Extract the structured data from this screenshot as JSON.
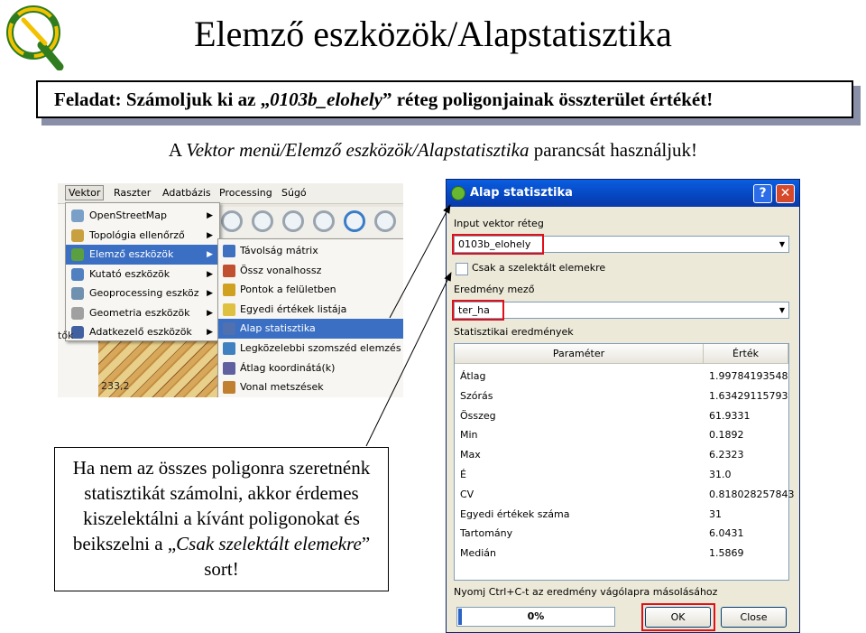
{
  "slide": {
    "title": "Elemző eszközök/Alapstatisztika",
    "task": {
      "prefix": "Feladat: Számoljuk ki az „",
      "layer": "0103b_elohely",
      "suffix": "” réteg poligonjainak összterület értékét!"
    },
    "instruction": {
      "prefix": "A ",
      "path": "Vektor menü/Elemző eszközök/Alapstatisztika",
      "suffix": " parancsát használjuk!"
    },
    "callout": {
      "text": "Ha nem az összes poligonra szeretnénk statisztikát számolni, akkor érdemes kiszelektálni a kívánt poligonokat és beikszelni a",
      "quote_open": "„",
      "quoted": "Csak szelektált elemekre",
      "quote_close": "” sort!"
    }
  },
  "menu_screenshot": {
    "menubar": [
      "Vektor",
      "Raszter",
      "Adatbázis",
      "Processing",
      "Súgó"
    ],
    "vector_menu": [
      {
        "label": "OpenStreetMap",
        "icon": "osm-icon",
        "color": "#7aa0c8"
      },
      {
        "label": "Topológia ellenőrző",
        "icon": "topology-icon",
        "color": "#c8a040"
      },
      {
        "label": "Elemző eszközök",
        "icon": "analysis-icon",
        "color": "#5aa040",
        "selected": true
      },
      {
        "label": "Kutató eszközök",
        "icon": "research-icon",
        "color": "#5080c0"
      },
      {
        "label": "Geoprocessing eszköz",
        "icon": "geoprocessing-icon",
        "color": "#7090b0"
      },
      {
        "label": "Geometria eszközök",
        "icon": "geometry-icon",
        "color": "#a0a0a0"
      },
      {
        "label": "Adatkezelő eszközök",
        "icon": "data-management-icon",
        "color": "#4060a0"
      }
    ],
    "analysis_submenu": [
      {
        "label": "Távolság mátrix",
        "icon": "distance-matrix-icon",
        "color": "#4070c0"
      },
      {
        "label": "Össz vonalhossz",
        "icon": "line-length-icon",
        "color": "#c05030"
      },
      {
        "label": "Pontok a felületben",
        "icon": "points-in-polygon-icon",
        "color": "#d0a020"
      },
      {
        "label": "Egyedi értékek listája",
        "icon": "unique-values-icon",
        "color": "#e0c040"
      },
      {
        "label": "Alap statisztika",
        "icon": "basic-stats-icon",
        "color": "#5070b0",
        "selected": true
      },
      {
        "label": "Legközelebbi szomszéd elemzés",
        "icon": "nearest-neighbour-icon",
        "color": "#4080c0"
      },
      {
        "label": "Átlag koordinátá(k)",
        "icon": "mean-coordinates-icon",
        "color": "#6060a0"
      },
      {
        "label": "Vonal metszések",
        "icon": "line-intersections-icon",
        "color": "#c08030"
      }
    ],
    "map_label": "233,2",
    "side_fragment": "tők"
  },
  "dialog": {
    "title": "Alap statisztika",
    "input_layer_label": "Input vektor réteg",
    "input_layer_value": "0103b_elohely",
    "selected_only_label": "Csak a szelektált elemekre",
    "selected_only_checked": false,
    "result_field_label": "Eredmény mező",
    "result_field_value": "ter_ha",
    "results_label": "Statisztikai eredmények",
    "columns": [
      "Paraméter",
      "Érték"
    ],
    "rows": [
      [
        "Átlag",
        "1.99784193548"
      ],
      [
        "Szórás",
        "1.63429115793"
      ],
      [
        "Összeg",
        "61.9331"
      ],
      [
        "Min",
        "0.1892"
      ],
      [
        "Max",
        "6.2323"
      ],
      [
        "É",
        "31.0"
      ],
      [
        "CV",
        "0.818028257843"
      ],
      [
        "Egyedi értékek száma",
        "31"
      ],
      [
        "Tartomány",
        "6.0431"
      ],
      [
        "Medián",
        "1.5869"
      ]
    ],
    "copy_hint": "Nyomj Ctrl+C-t az eredmény vágólapra másolásához",
    "progress_value": 0,
    "progress_text": "0%",
    "ok_label": "OK",
    "close_label": "Close",
    "help_glyph": "?",
    "close_glyph": "✕"
  },
  "colors": {
    "highlight": "#3b6fc4",
    "red_box": "#e0101a",
    "titlebar": "#0546c0"
  }
}
